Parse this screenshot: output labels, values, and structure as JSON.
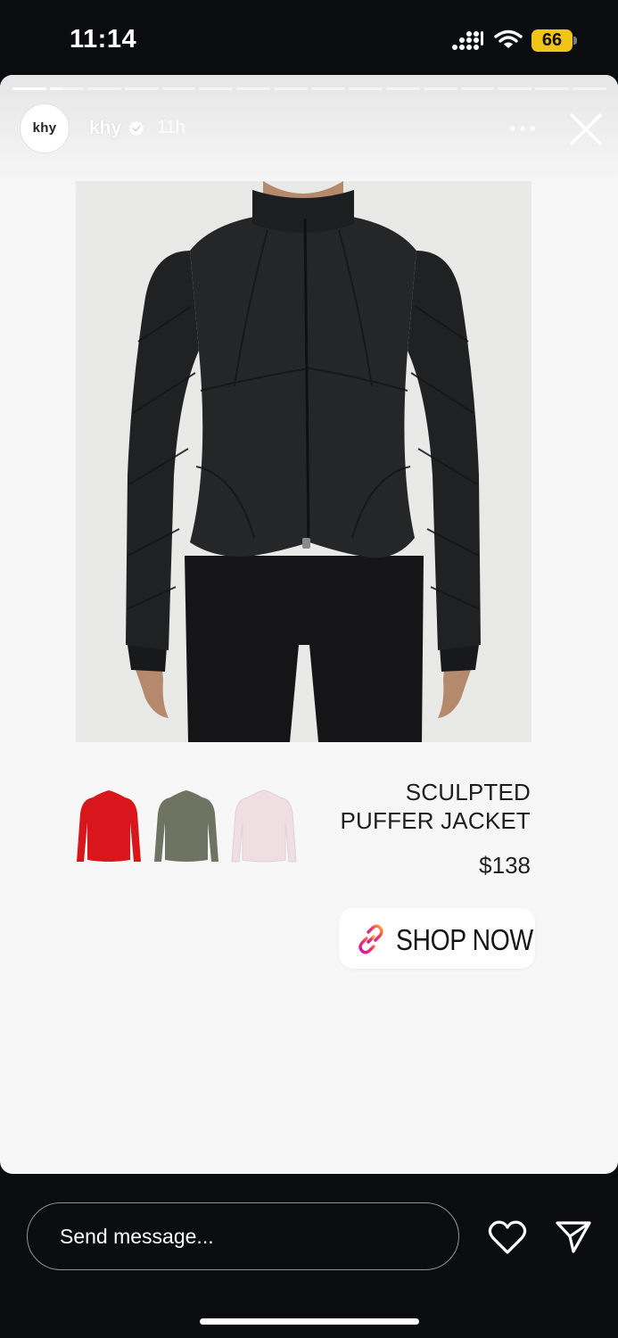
{
  "status_bar": {
    "time": "11:14",
    "battery_level": "66",
    "colors": {
      "battery": "#f2c418"
    }
  },
  "story": {
    "progress": {
      "segment_count": 16,
      "current_segment": 2,
      "current_fraction": 0.35
    },
    "account": {
      "avatar_text": "khy",
      "username": "khy",
      "verified": true,
      "time_ago": "11h"
    },
    "icons": {
      "more": "more-icon",
      "close": "close-icon",
      "verified": "verified-badge-icon"
    },
    "product": {
      "image": "black-puffer-jacket-photo",
      "name_line1": "SCULPTED",
      "name_line2": "PUFFER JACKET",
      "price": "$138",
      "swatches": [
        {
          "color_name": "red",
          "hex": "#d8161c"
        },
        {
          "color_name": "olive",
          "hex": "#6e7461"
        },
        {
          "color_name": "pink",
          "hex": "#efdfe3"
        }
      ]
    },
    "link_sticker": {
      "label": "SHOP NOW",
      "icon": "link-icon"
    }
  },
  "bottom_bar": {
    "message_placeholder": "Send message...",
    "icons": {
      "like": "heart-icon",
      "share": "send-icon"
    }
  }
}
